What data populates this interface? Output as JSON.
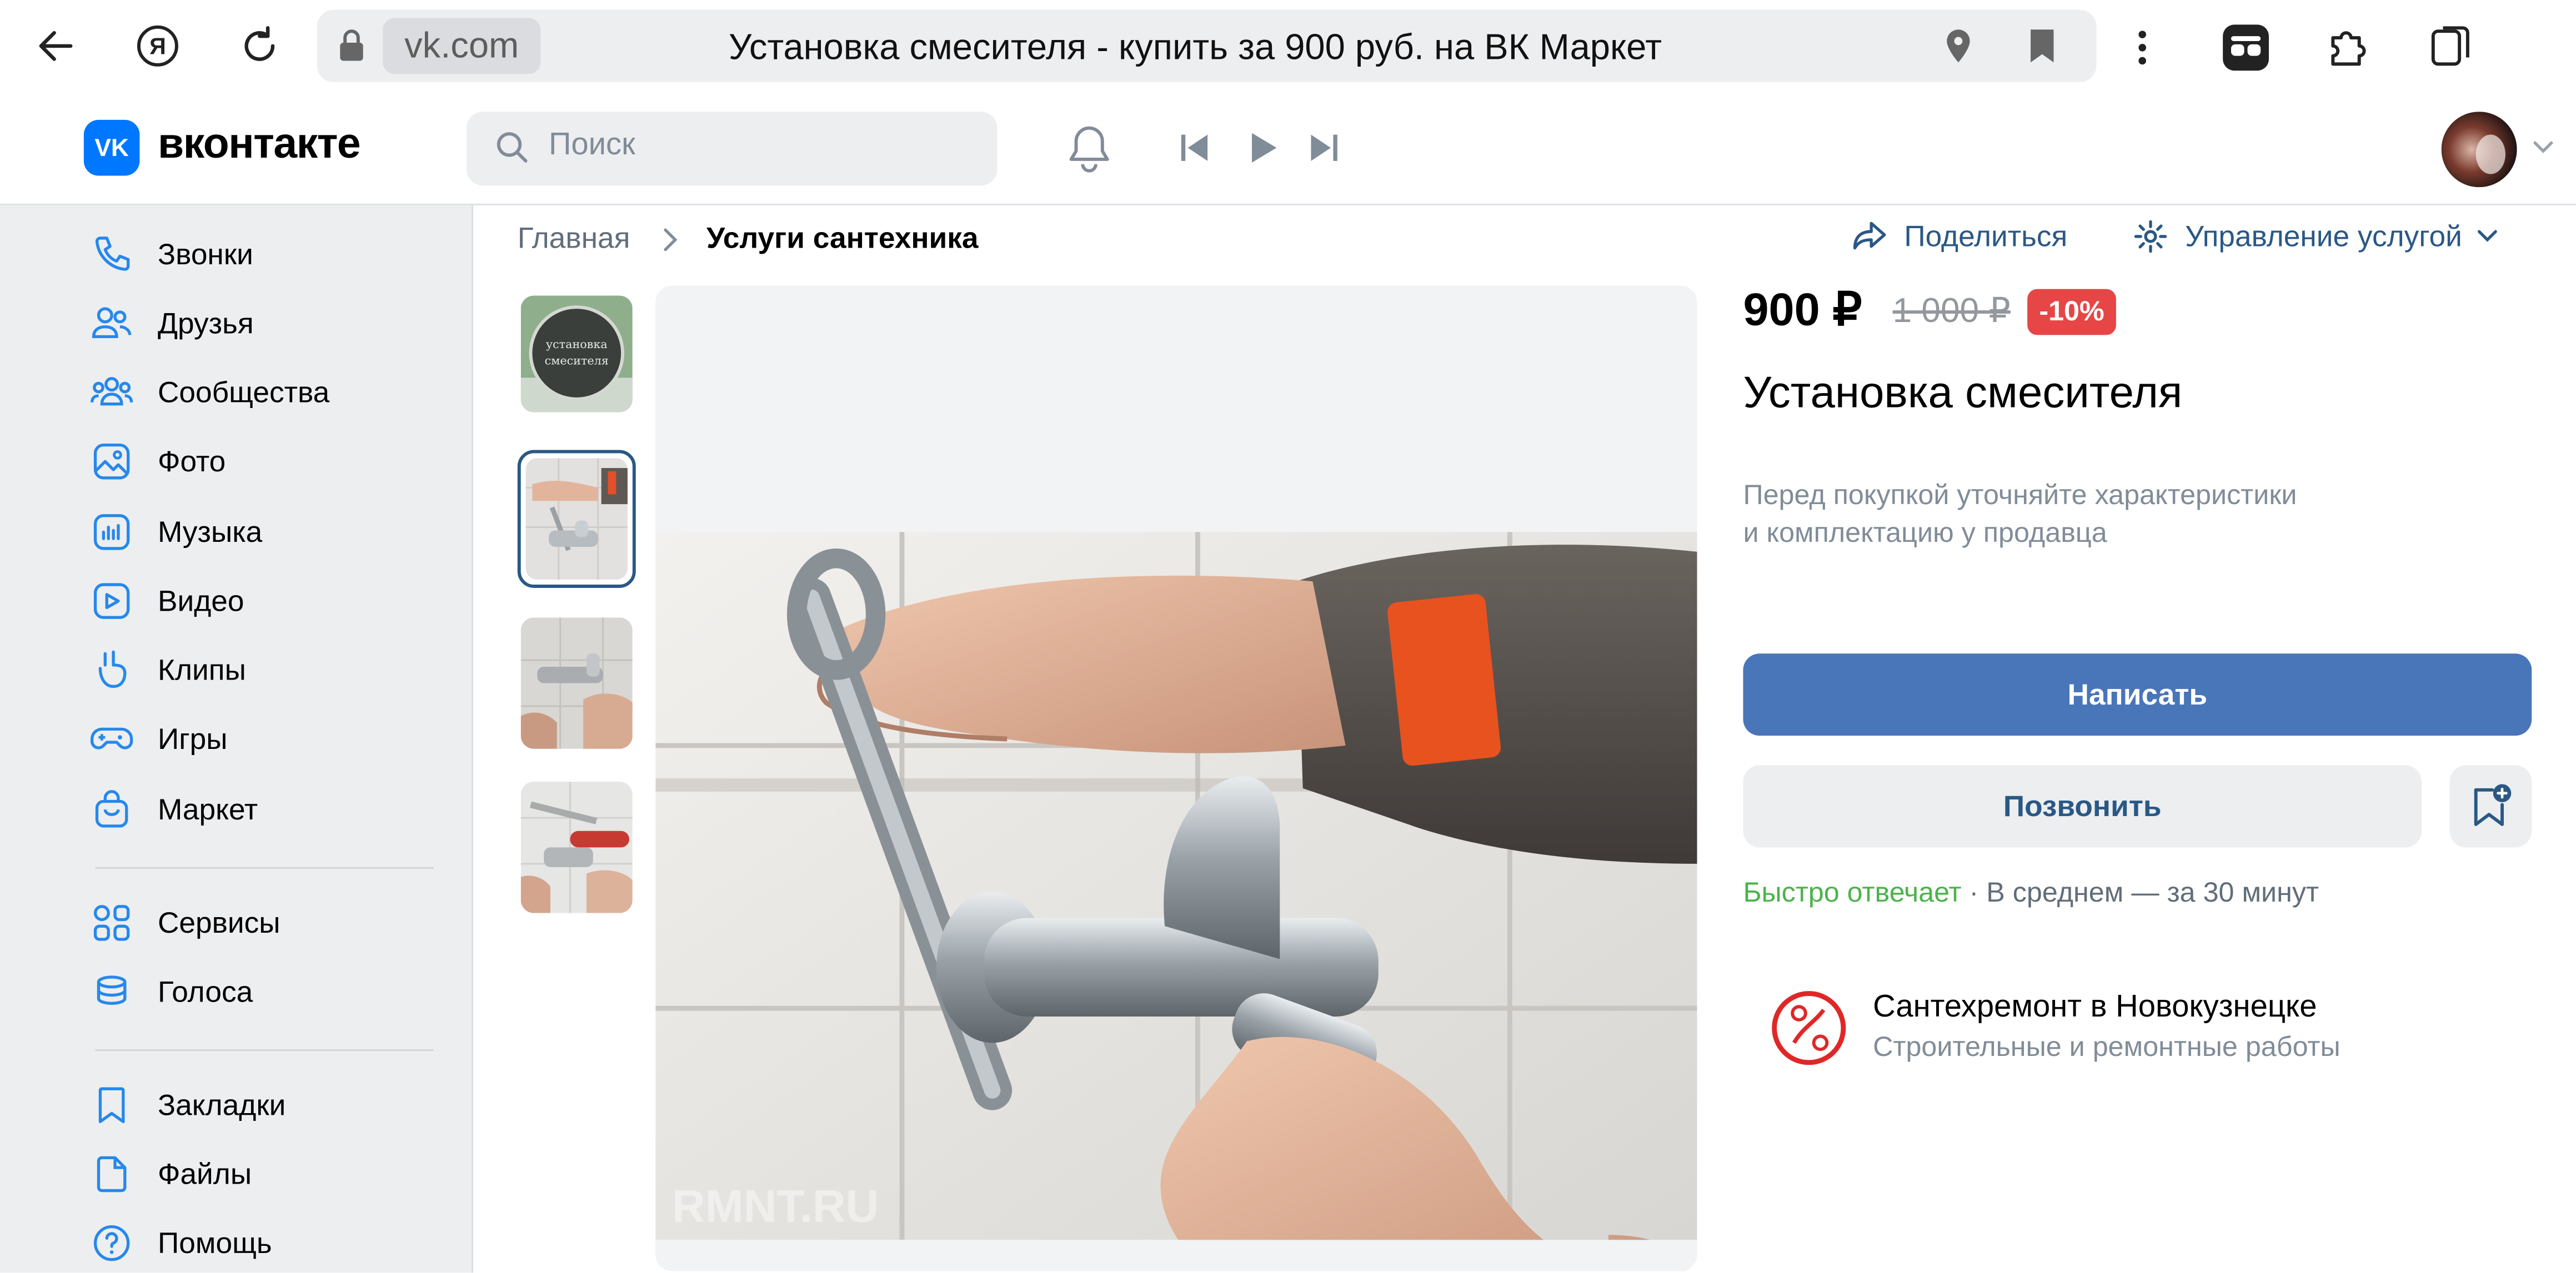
{
  "browser": {
    "domain": "vk.com",
    "tab_title": "Установка смесителя - купить за 900 руб. на ВК Маркет"
  },
  "header": {
    "logo_text": "вконтакте",
    "logo_mark": "VK",
    "search_placeholder": "Поиск"
  },
  "sidebar": {
    "items": [
      {
        "label": "Звонки",
        "icon": "phone-icon"
      },
      {
        "label": "Друзья",
        "icon": "friends-icon"
      },
      {
        "label": "Сообщества",
        "icon": "communities-icon"
      },
      {
        "label": "Фото",
        "icon": "photo-icon"
      },
      {
        "label": "Музыка",
        "icon": "music-icon"
      },
      {
        "label": "Видео",
        "icon": "video-icon"
      },
      {
        "label": "Клипы",
        "icon": "clips-icon"
      },
      {
        "label": "Игры",
        "icon": "games-icon"
      },
      {
        "label": "Маркет",
        "icon": "market-icon"
      },
      {
        "label": "Сервисы",
        "icon": "services-icon"
      },
      {
        "label": "Голоса",
        "icon": "votes-icon"
      },
      {
        "label": "Закладки",
        "icon": "bookmarks-icon"
      },
      {
        "label": "Файлы",
        "icon": "files-icon"
      },
      {
        "label": "Помощь",
        "icon": "help-icon"
      }
    ]
  },
  "breadcrumb": {
    "home": "Главная",
    "current": "Услуги сантехника"
  },
  "actions": {
    "share": "Поделиться",
    "manage": "Управление услугой"
  },
  "gallery": {
    "thumb1_caption": "установка смесителя",
    "watermark": "RMNT.RU"
  },
  "product": {
    "price": "900 ₽",
    "old_price": "1 000 ₽",
    "discount": "-10%",
    "title": "Установка смесителя",
    "disclaimer_line1": "Перед покупкой уточняйте характеристики",
    "disclaimer_line2": "и комплектацию у продавца",
    "write_button": "Написать",
    "call_button": "Позвонить",
    "response_fast": "Быстро отвечает",
    "response_time": " · В среднем — за 30 минут"
  },
  "seller": {
    "name": "Сантехремонт в Новокузнецке",
    "category": "Строительные и ремонтные работы"
  },
  "colors": {
    "accent": "#4975b9",
    "link": "#2a5885",
    "discount_badge": "#e64646",
    "fast_response": "#4bb34b",
    "vk_blue": "#0077ff"
  }
}
